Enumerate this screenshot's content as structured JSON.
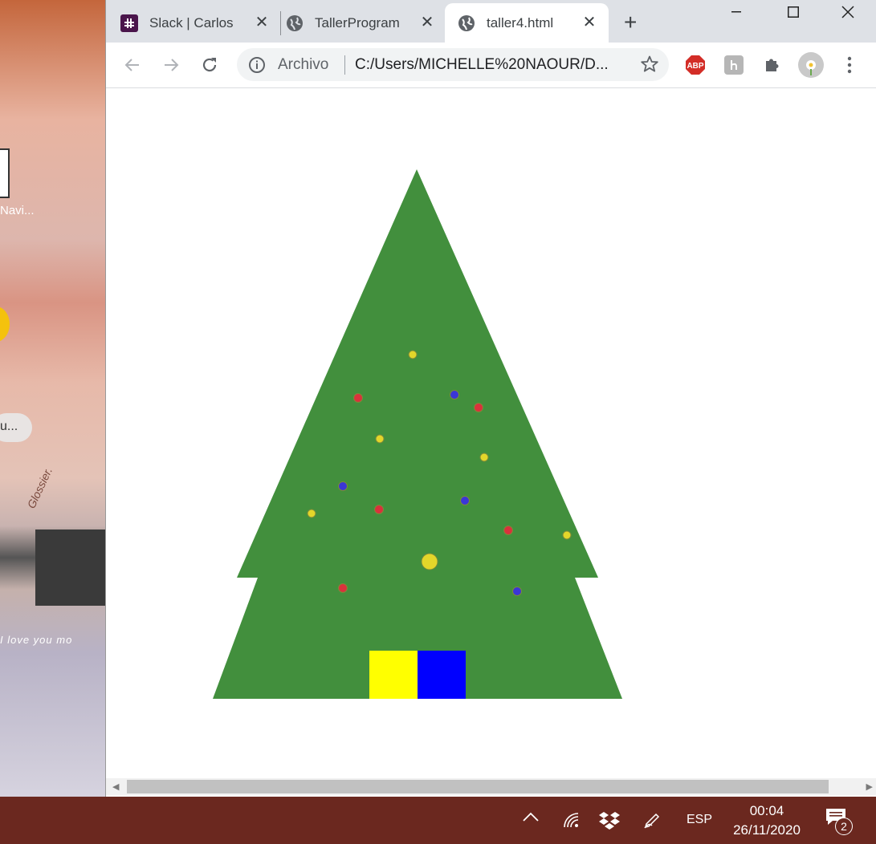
{
  "desktop": {
    "icon_labels": [
      "Navi...",
      "u..."
    ],
    "wallpaper_text": "I love you mo",
    "wallpaper_product": "Glossier."
  },
  "browser": {
    "tabs": [
      {
        "title": "Slack | Carlos",
        "icon": "slack-icon"
      },
      {
        "title": "TallerProgram",
        "icon": "globe-icon"
      },
      {
        "title": "taller4.html",
        "icon": "globe-icon",
        "active": true
      }
    ],
    "omnibox": {
      "scheme": "Archivo",
      "url": "C:/Users/MICHELLE%20NAOUR/D..."
    },
    "extensions": [
      "abp-icon",
      "h-extension-icon",
      "puzzle-icon",
      "profile-avatar-icon"
    ],
    "abp_label": "ABP",
    "horizontal_scroll_fraction": 0.96
  },
  "page": {
    "tree_color": "#428f3d",
    "gift_colors": [
      "#ffff00",
      "#0000ff"
    ],
    "ornament_colors": {
      "yellow": "#e3d62a",
      "red": "#d9323c",
      "blue": "#3b36d6"
    }
  },
  "taskbar": {
    "language": "ESP",
    "time": "00:04",
    "date": "26/11/2020",
    "notification_count": "2"
  }
}
